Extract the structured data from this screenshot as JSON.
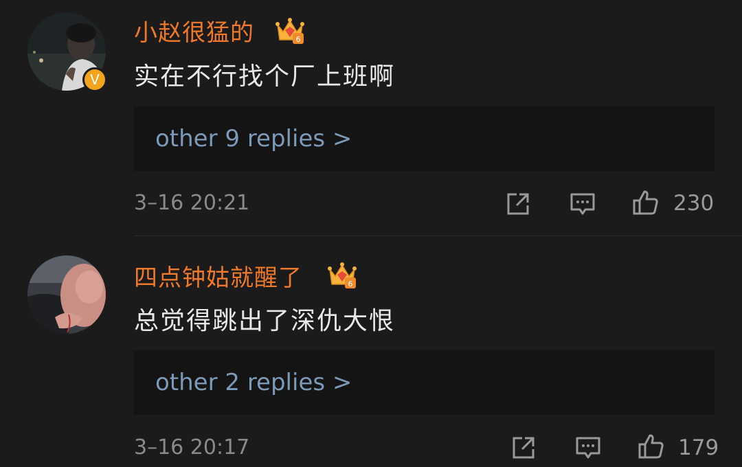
{
  "comments": [
    {
      "username": "小赵很猛的",
      "text": "实在不行找个厂上班啊",
      "replies_label": "other 9 replies >",
      "timestamp": "3–16 20:21",
      "likes": "230",
      "verified": true,
      "badge_level": "6",
      "verified_mark": "V"
    },
    {
      "username": "四点钟姑就醒了",
      "text": "总觉得跳出了深仇大恨",
      "replies_label": "other 2 replies >",
      "timestamp": "3–16 20:17",
      "likes": "179",
      "verified": false,
      "badge_level": "6"
    }
  ],
  "colors": {
    "background": "#1b1b1b",
    "username": "#f0782a",
    "reply_link": "#7c9ab8",
    "meta_text": "#8a8a8a",
    "verified_badge": "#f2a51b"
  },
  "icons": {
    "share": "share-icon",
    "comment": "comment-icon",
    "like": "thumbs-up-icon",
    "crown": "crown-badge-icon"
  }
}
